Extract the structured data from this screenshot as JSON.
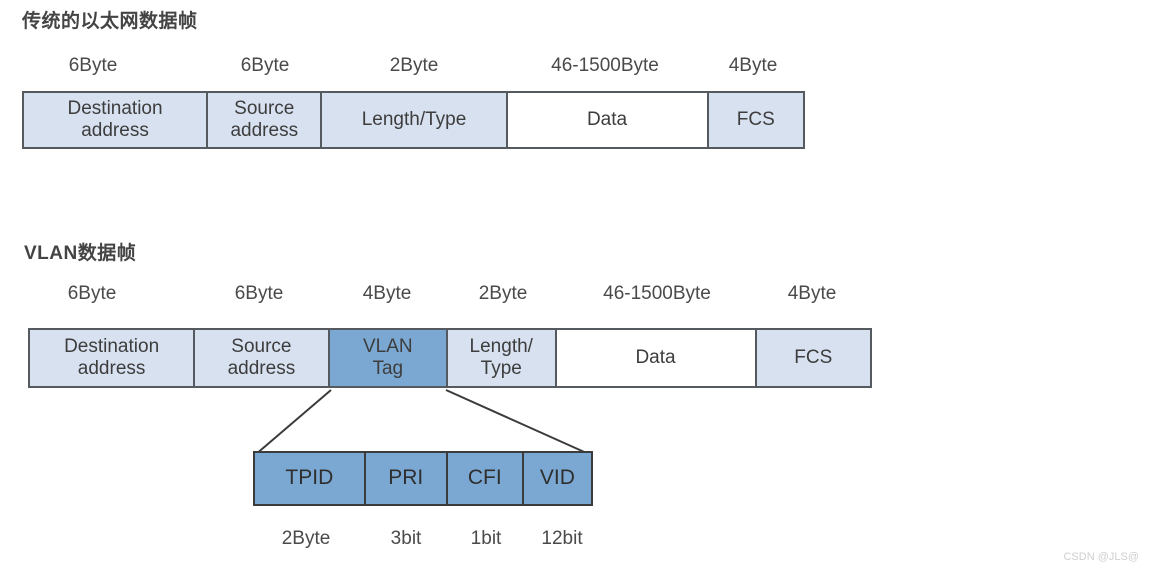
{
  "colors": {
    "cell_light": "#d8e1f0",
    "cell_white": "#ffffff",
    "cell_mid": "#7ba8d2",
    "border": "#555a5e",
    "tag_border": "#3b3b3b",
    "text": "#3d3d3d",
    "watermark": "#cfcfcf"
  },
  "classic_frame": {
    "title": "传统的以太网数据帧",
    "sizes": [
      "6Byte",
      "6Byte",
      "2Byte",
      "46-1500Byte",
      "4Byte"
    ],
    "fields": [
      {
        "label": "Destination\naddress",
        "fill": "light"
      },
      {
        "label": "Source\naddress",
        "fill": "light"
      },
      {
        "label": "Length/Type",
        "fill": "light"
      },
      {
        "label": "Data",
        "fill": "white"
      },
      {
        "label": "FCS",
        "fill": "light"
      }
    ]
  },
  "vlan_frame": {
    "title": "VLAN数据帧",
    "sizes": [
      "6Byte",
      "6Byte",
      "4Byte",
      "2Byte",
      "46-1500Byte",
      "4Byte"
    ],
    "fields": [
      {
        "label": "Destination\naddress",
        "fill": "light"
      },
      {
        "label": "Source\naddress",
        "fill": "light"
      },
      {
        "label": "VLAN\nTag",
        "fill": "mid"
      },
      {
        "label": "Length/\nType",
        "fill": "light"
      },
      {
        "label": "Data",
        "fill": "white"
      },
      {
        "label": "FCS",
        "fill": "light"
      }
    ]
  },
  "vlan_tag_detail": {
    "fields": [
      {
        "label": "TPID",
        "size": "2Byte"
      },
      {
        "label": "PRI",
        "size": "3bit"
      },
      {
        "label": "CFI",
        "size": "1bit"
      },
      {
        "label": "VID",
        "size": "12bit"
      }
    ]
  },
  "watermark": {
    "text": "CSDN @JLS@"
  }
}
